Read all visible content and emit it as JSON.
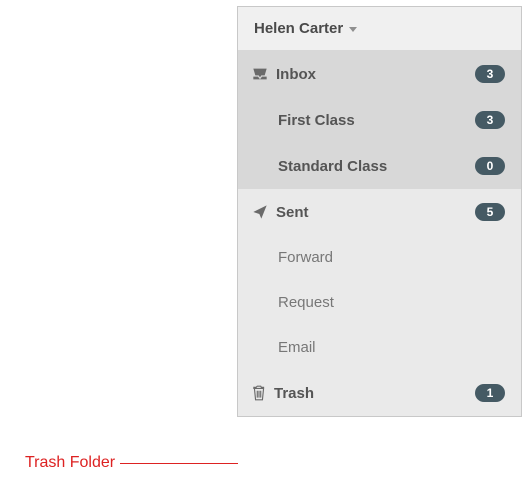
{
  "header": {
    "user_name": "Helen Carter"
  },
  "folders": {
    "inbox": {
      "label": "Inbox",
      "count": "3",
      "subs": [
        {
          "label": "First Class",
          "count": "3"
        },
        {
          "label": "Standard Class",
          "count": "0"
        }
      ]
    },
    "sent": {
      "label": "Sent",
      "count": "5",
      "subs": [
        {
          "label": "Forward"
        },
        {
          "label": "Request"
        },
        {
          "label": "Email"
        }
      ]
    },
    "trash": {
      "label": "Trash",
      "count": "1"
    }
  },
  "annotation": {
    "label": "Trash Folder"
  }
}
